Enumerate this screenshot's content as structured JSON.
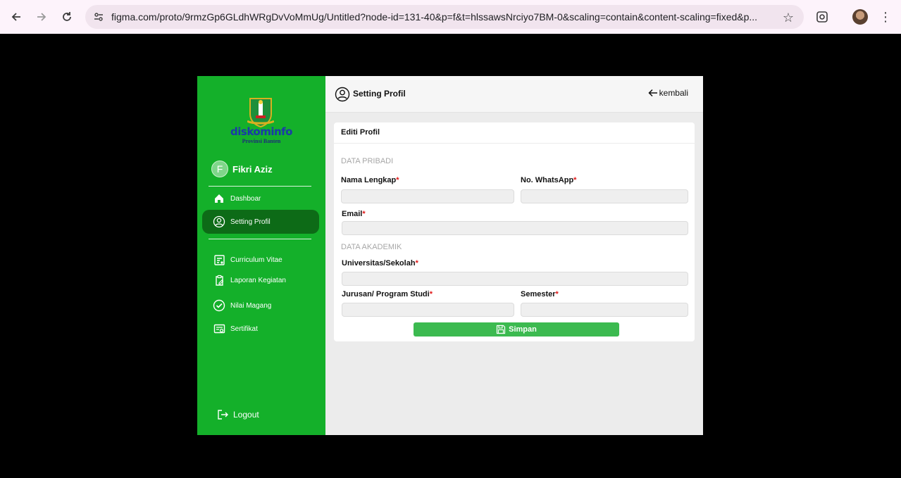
{
  "browser": {
    "url": "figma.com/proto/9rmzGp6GLdhWRgDvVoMmUg/Untitled?node-id=131-40&p=f&t=hlssawsNrciyo7BM-0&scaling=contain&content-scaling=fixed&p..."
  },
  "sidebar": {
    "logo_text": "diskominfo",
    "logo_subtext": "Provinsi Banten",
    "user_initial": "F",
    "user_name": "Fikri Aziz",
    "items": [
      {
        "label": "Dashboar"
      },
      {
        "label": "Setting Profil"
      },
      {
        "label": "Curriculum Vitae"
      },
      {
        "label": "Laporan Kegiatan"
      },
      {
        "label": "Nilai Magang"
      },
      {
        "label": "Sertifikat"
      }
    ],
    "logout_label": "Logout"
  },
  "topbar": {
    "title": "Setting Profil",
    "back_label": "kembali"
  },
  "form": {
    "card_title": "Editi Profil",
    "section_personal": "DATA PRIBADI",
    "section_academic": "DATA AKADEMIK",
    "fields": {
      "full_name": "Nama Lengkap",
      "whatsapp": "No. WhatsApp",
      "email": "Email",
      "university": "Universitas/Sekolah",
      "major": "Jurusan/ Program Studi",
      "semester": "Semester"
    },
    "required_mark": "*",
    "save_label": "Simpan"
  },
  "colors": {
    "sidebar_bg": "#14b02a",
    "active_item_bg": "#0d6b17",
    "save_button": "#3cba50",
    "required": "#e01818"
  }
}
